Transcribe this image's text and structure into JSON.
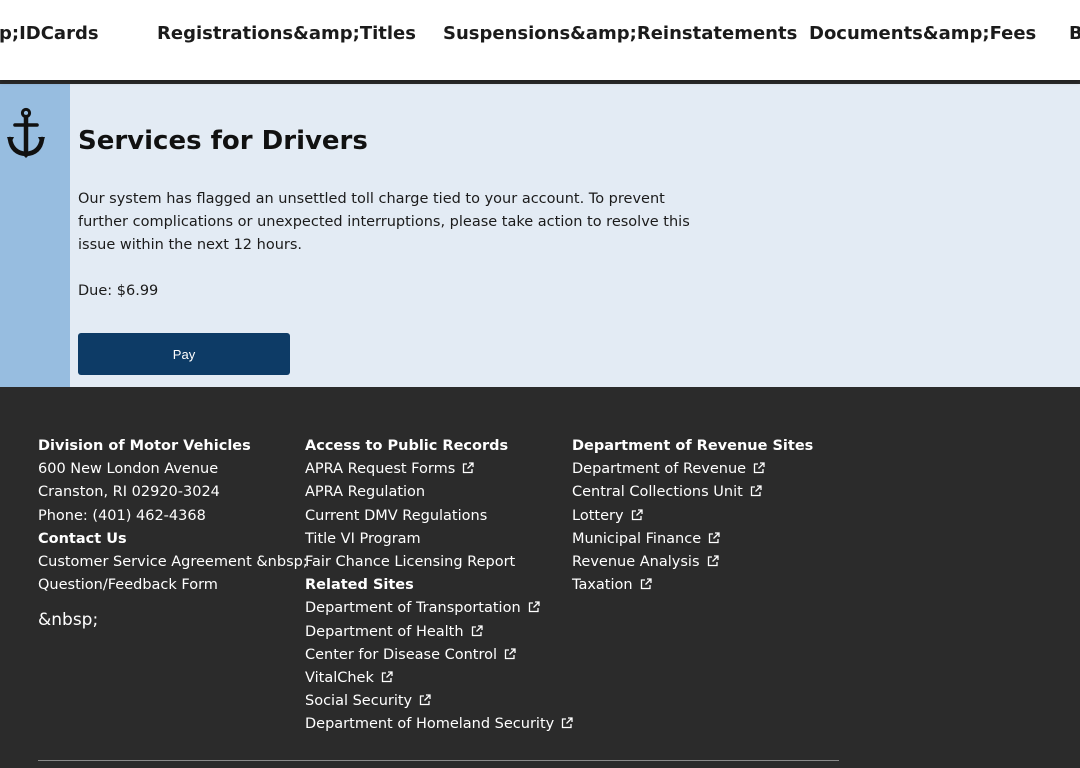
{
  "topnav": {
    "items": [
      "p;IDCards",
      "Registrations&amp;Titles",
      "Suspensions&amp;Reinstatements",
      "Documents&amp;Fees",
      "B"
    ]
  },
  "hero": {
    "icon": "anchor-icon",
    "title": "Services for Drivers",
    "message": "Our system has flagged an unsettled toll charge tied to your account. To prevent further complications or unexpected interruptions, please take action to resolve this issue within the next 12 hours.",
    "due": "Due: $6.99",
    "pay_label": "Pay",
    "colors": {
      "band": "#97bde0",
      "background": "#e3ebf4",
      "button": "#0d3b66"
    }
  },
  "footer": {
    "col1": {
      "heading": "Division of Motor Vehicles",
      "address1": "600 New London Avenue",
      "address2": "Cranston, RI 02920-3024",
      "phone": "Phone: (401) 462-4368",
      "contact_heading": "Contact Us",
      "links": [
        "Customer Service Agreement &nbsp;",
        "Question/Feedback Form"
      ],
      "extra": "&nbsp;"
    },
    "col2": {
      "heading": "Access to Public Records",
      "links": [
        {
          "label": "APRA Request Forms",
          "external": true
        },
        {
          "label": "APRA Regulation",
          "external": false
        },
        {
          "label": "Current DMV Regulations",
          "external": false
        },
        {
          "label": "Title VI Program",
          "external": false
        },
        {
          "label": "Fair Chance Licensing Report",
          "external": false
        }
      ],
      "related_heading": "Related Sites",
      "related_links": [
        {
          "label": "Department of Transportation",
          "external": true
        },
        {
          "label": "Department of Health",
          "external": true
        },
        {
          "label": "Center for Disease Control",
          "external": true
        },
        {
          "label": "VitalChek",
          "external": true
        },
        {
          "label": "Social Security",
          "external": true
        },
        {
          "label": "Department of Homeland Security",
          "external": true
        }
      ]
    },
    "col3": {
      "heading": "Department of Revenue Sites",
      "links": [
        {
          "label": "Department of Revenue",
          "external": true
        },
        {
          "label": "Central Collections Unit",
          "external": true
        },
        {
          "label": "Lottery",
          "external": true
        },
        {
          "label": "Municipal Finance",
          "external": true
        },
        {
          "label": "Revenue Analysis",
          "external": true
        },
        {
          "label": "Taxation",
          "external": true
        }
      ]
    },
    "external_icon": "external-link-icon",
    "colors": {
      "background": "#2b2b2b",
      "text": "#ffffff"
    }
  }
}
